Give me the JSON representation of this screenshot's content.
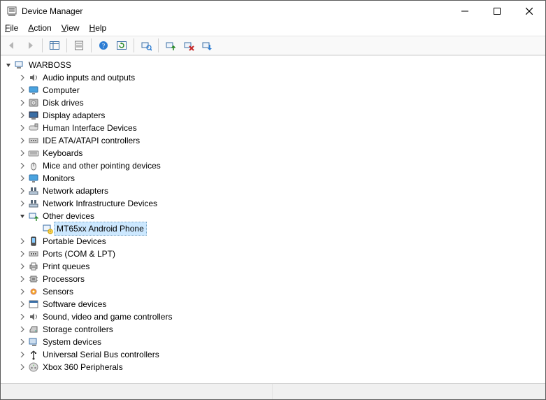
{
  "window": {
    "title": "Device Manager"
  },
  "menu": {
    "file": "File",
    "action": "Action",
    "view": "View",
    "help": "Help"
  },
  "toolbar": {
    "back": "Back",
    "forward": "Forward",
    "show_hide": "Show/Hide Console Tree",
    "properties": "Properties",
    "help": "Help",
    "refresh": "Refresh",
    "scan": "Scan for hardware changes",
    "update": "Update driver",
    "uninstall": "Uninstall device",
    "disable": "Disable device"
  },
  "tree": {
    "root": {
      "label": "WARBOSS"
    },
    "items": [
      {
        "label": "Audio inputs and outputs",
        "icon": "speaker"
      },
      {
        "label": "Computer",
        "icon": "monitor"
      },
      {
        "label": "Disk drives",
        "icon": "disk"
      },
      {
        "label": "Display adapters",
        "icon": "display"
      },
      {
        "label": "Human Interface Devices",
        "icon": "hid"
      },
      {
        "label": "IDE ATA/ATAPI controllers",
        "icon": "ide"
      },
      {
        "label": "Keyboards",
        "icon": "keyboard"
      },
      {
        "label": "Mice and other pointing devices",
        "icon": "mouse"
      },
      {
        "label": "Monitors",
        "icon": "monitor"
      },
      {
        "label": "Network adapters",
        "icon": "network"
      },
      {
        "label": "Network Infrastructure Devices",
        "icon": "network"
      },
      {
        "label": "Other devices",
        "icon": "other",
        "expanded": true,
        "children": [
          {
            "label": "MT65xx Android Phone",
            "icon": "unknown",
            "selected": true
          }
        ]
      },
      {
        "label": "Portable Devices",
        "icon": "portable"
      },
      {
        "label": "Ports (COM & LPT)",
        "icon": "port"
      },
      {
        "label": "Print queues",
        "icon": "printer"
      },
      {
        "label": "Processors",
        "icon": "cpu"
      },
      {
        "label": "Sensors",
        "icon": "sensor"
      },
      {
        "label": "Software devices",
        "icon": "software"
      },
      {
        "label": "Sound, video and game controllers",
        "icon": "speaker"
      },
      {
        "label": "Storage controllers",
        "icon": "storage"
      },
      {
        "label": "System devices",
        "icon": "system"
      },
      {
        "label": "Universal Serial Bus controllers",
        "icon": "usb"
      },
      {
        "label": "Xbox 360 Peripherals",
        "icon": "xbox"
      }
    ]
  }
}
